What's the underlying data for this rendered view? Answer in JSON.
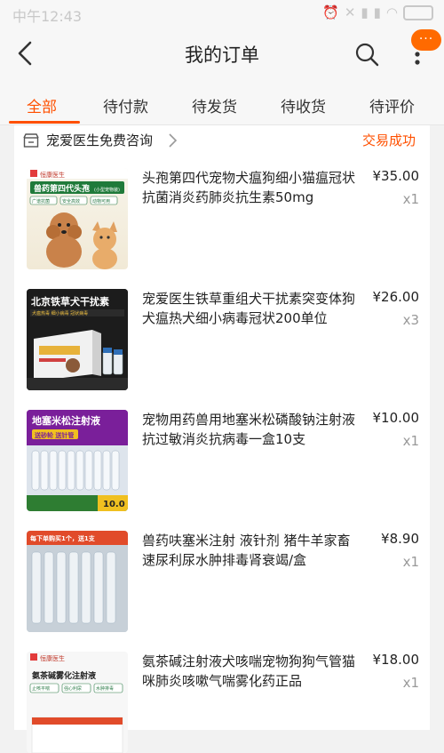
{
  "status_bar": {
    "time": "中午12:43"
  },
  "header": {
    "title": "我的订单",
    "badge": "···"
  },
  "tabs": [
    "全部",
    "待付款",
    "待发货",
    "待收货",
    "待评价"
  ],
  "order": {
    "shop_name": "宠爱医生免费咨询",
    "status": "交易成功",
    "items": [
      {
        "title": "头孢第四代宠物犬瘟狗细小猫瘟冠状抗菌消炎药肺炎抗生素50mg",
        "price": "¥35.00",
        "qty": "x1"
      },
      {
        "title": "宠爱医生铁草重组犬干扰素突变体狗犬瘟热犬细小病毒冠状200单位",
        "price": "¥26.00",
        "qty": "x3"
      },
      {
        "title": "宠物用药兽用地塞米松磷酸钠注射液抗过敏消炎抗病毒一盒10支",
        "price": "¥10.00",
        "qty": "x1"
      },
      {
        "title": "兽药呋塞米注射 液针剂 猪牛羊家畜速尿利尿水肿排毒肾衰竭/盒",
        "price": "¥8.90",
        "qty": "x1"
      },
      {
        "title": "氨茶碱注射液犬咳喘宠物狗狗气管猫咪肺炎咳嗽气喘雾化药正品",
        "price": "¥18.00",
        "qty": "x1"
      }
    ]
  },
  "thumbnails": {
    "t1": {
      "brand": "恒康医生",
      "title": "兽药第四代头孢",
      "sub": "(小型宠物装)",
      "tags": [
        "广谱抗菌",
        "安全高效",
        "动物可用"
      ]
    },
    "t2": {
      "title": "北京铁草犬干扰素",
      "sub": "犬瘟热毒 细小病毒 冠状病毒"
    },
    "t3": {
      "title": "地塞米松注射液",
      "sub": "送砂轮 送针管",
      "price": "10.0"
    },
    "t4": {
      "title": "每下单购买1个，送1支"
    },
    "t5": {
      "brand": "恒康医生",
      "title": "氨茶碱雾化注射液",
      "tags": [
        "止咳平喘",
        "强心利尿",
        "水肿排毒"
      ]
    }
  }
}
